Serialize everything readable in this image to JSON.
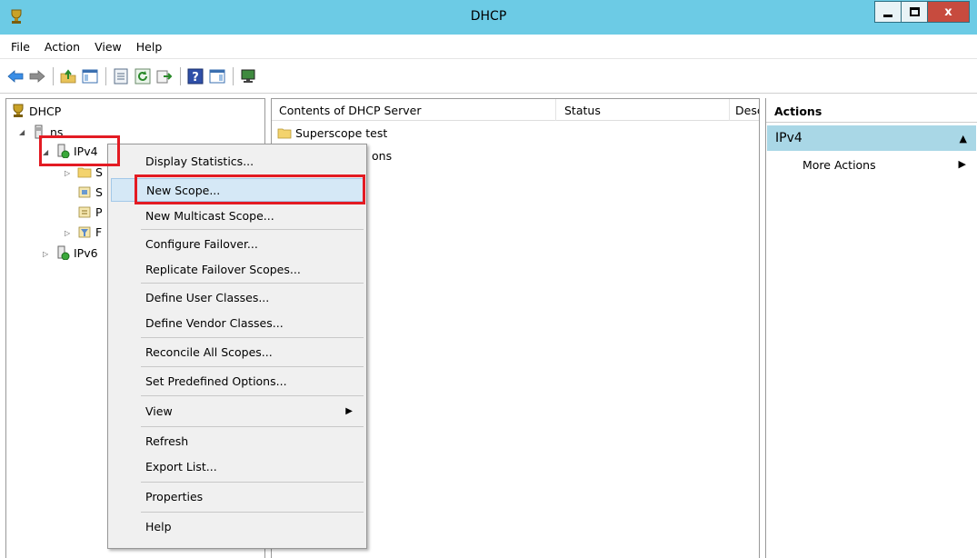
{
  "window": {
    "title": "DHCP",
    "close_label": "x"
  },
  "menubar": [
    {
      "label": "File"
    },
    {
      "label": "Action"
    },
    {
      "label": "View"
    },
    {
      "label": "Help"
    }
  ],
  "toolbar": [
    {
      "icon": "back-arrow-icon"
    },
    {
      "icon": "forward-arrow-icon"
    },
    {
      "icon": "up-folder-icon"
    },
    {
      "icon": "show-hide-tree-icon"
    },
    {
      "icon": "properties-icon"
    },
    {
      "icon": "refresh-icon"
    },
    {
      "icon": "export-list-icon"
    },
    {
      "icon": "help-icon"
    },
    {
      "icon": "show-hide-action-pane-icon"
    },
    {
      "icon": "monitor-icon"
    }
  ],
  "tree": {
    "root": "DHCP",
    "server": "ns",
    "ipv4": "IPv4",
    "children": [
      "S",
      "S",
      "P",
      "F"
    ],
    "ipv6": "IPv6"
  },
  "list": {
    "columns": [
      "Contents of DHCP Server",
      "Status",
      "Desc"
    ],
    "rows": [
      "Superscope test",
      "ons"
    ]
  },
  "actions": {
    "header": "Actions",
    "section": "IPv4",
    "item": "More Actions"
  },
  "context_menu": [
    "Display Statistics...",
    "New Scope...",
    "New Multicast Scope...",
    "Configure Failover...",
    "Replicate Failover Scopes...",
    "Define User Classes...",
    "Define Vendor Classes...",
    "Reconcile All Scopes...",
    "Set Predefined Options...",
    "View",
    "Refresh",
    "Export List...",
    "Properties",
    "Help"
  ],
  "colors": {
    "titlebar": "#6ccbe5",
    "highlight": "#d5e8f6",
    "annotation": "#e31b23",
    "actions_section": "#a9d7e6"
  }
}
